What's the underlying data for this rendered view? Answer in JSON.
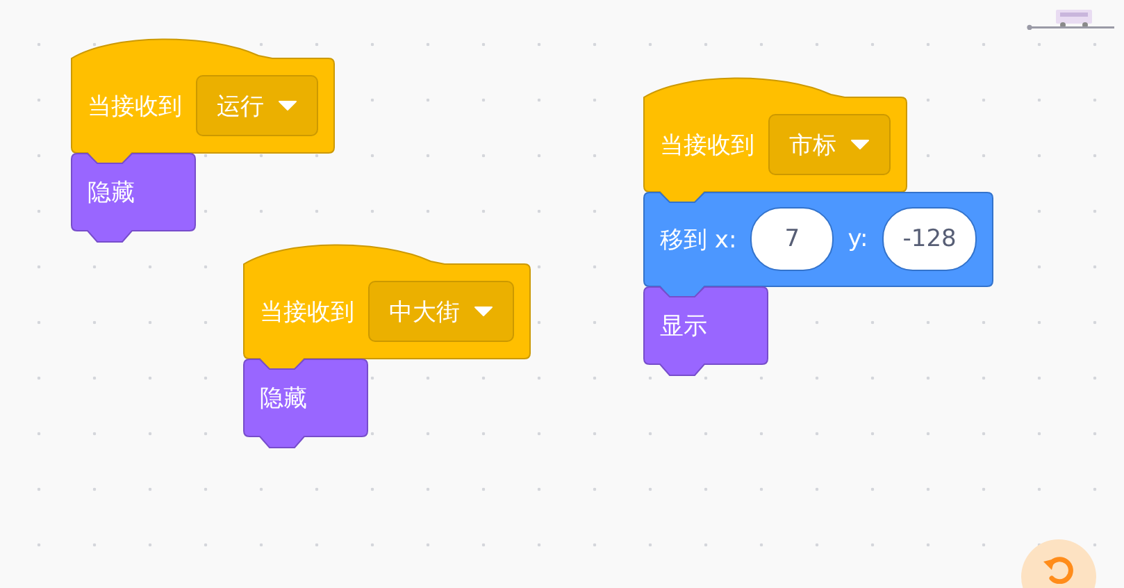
{
  "stacks": [
    {
      "blocks": [
        {
          "kind": "event",
          "parts": [
            {
              "kind": "text",
              "text": "当接收到"
            },
            {
              "kind": "dropdown",
              "value": "运行"
            }
          ]
        },
        {
          "kind": "looks",
          "parts": [
            {
              "kind": "text",
              "text": "隐藏"
            }
          ]
        }
      ]
    },
    {
      "blocks": [
        {
          "kind": "event",
          "parts": [
            {
              "kind": "text",
              "text": "当接收到"
            },
            {
              "kind": "dropdown",
              "value": "中大街"
            }
          ]
        },
        {
          "kind": "looks",
          "parts": [
            {
              "kind": "text",
              "text": "隐藏"
            }
          ]
        }
      ]
    },
    {
      "blocks": [
        {
          "kind": "event",
          "parts": [
            {
              "kind": "text",
              "text": "当接收到"
            },
            {
              "kind": "dropdown",
              "value": "市标"
            }
          ]
        },
        {
          "kind": "motion",
          "parts": [
            {
              "kind": "text",
              "text": "移到 x:"
            },
            {
              "kind": "input",
              "value": "7"
            },
            {
              "kind": "text",
              "text": "y:"
            },
            {
              "kind": "input",
              "value": "-128"
            }
          ]
        },
        {
          "kind": "looks",
          "parts": [
            {
              "kind": "text",
              "text": "显示"
            }
          ]
        }
      ]
    }
  ]
}
